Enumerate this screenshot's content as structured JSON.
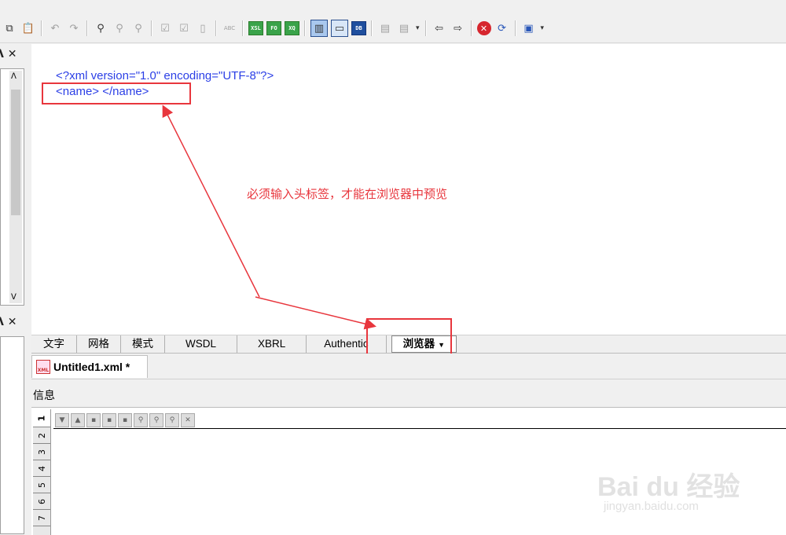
{
  "toolbar": {
    "icons": [
      "copy-icon",
      "paste-icon",
      "undo-icon",
      "redo-icon",
      "find-icon",
      "find-next-icon",
      "replace-icon",
      "check-wellformed-icon",
      "validate-icon",
      "view-split-icon",
      "spellcheck-icon",
      "xsl-transform-icon",
      "xsl-fo-icon",
      "xquery-icon",
      "text-view-icon",
      "grid-view-icon",
      "db-icon",
      "dtd-icon",
      "file-icon",
      "back-icon",
      "forward-icon",
      "stop-icon",
      "refresh-icon",
      "browser-icon"
    ],
    "xsl_label": "XSL",
    "fo_label": "FO",
    "xq_label": "XQ",
    "db_label": "DB",
    "abc_label": "ABC"
  },
  "left_panels": {
    "top_controls": "ᐱ ✕",
    "bottom_controls": "ᐱ ✕"
  },
  "editor": {
    "line1": "<?xml version=\"1.0\" encoding=\"UTF-8\"?>",
    "line2": "<name> </name>"
  },
  "annotation": {
    "note": "必须输入头标签，才能在浏览器中预览",
    "color": "#e8363d"
  },
  "view_tabs": [
    {
      "label": "文字"
    },
    {
      "label": "网格"
    },
    {
      "label": "模式"
    },
    {
      "label": "WSDL"
    },
    {
      "label": "XBRL"
    },
    {
      "label": "Authentic"
    },
    {
      "label": "浏览器",
      "active": true
    }
  ],
  "document_tab": {
    "icon_label": "XML",
    "label": "Untitled1.xml *"
  },
  "info_panel": {
    "title": "信息",
    "vertical_tabs": [
      "1",
      "2",
      "3",
      "4",
      "5",
      "6",
      "7"
    ]
  },
  "watermark": {
    "brand": "Bai du 经验",
    "url": "jingyan.baidu.com"
  }
}
